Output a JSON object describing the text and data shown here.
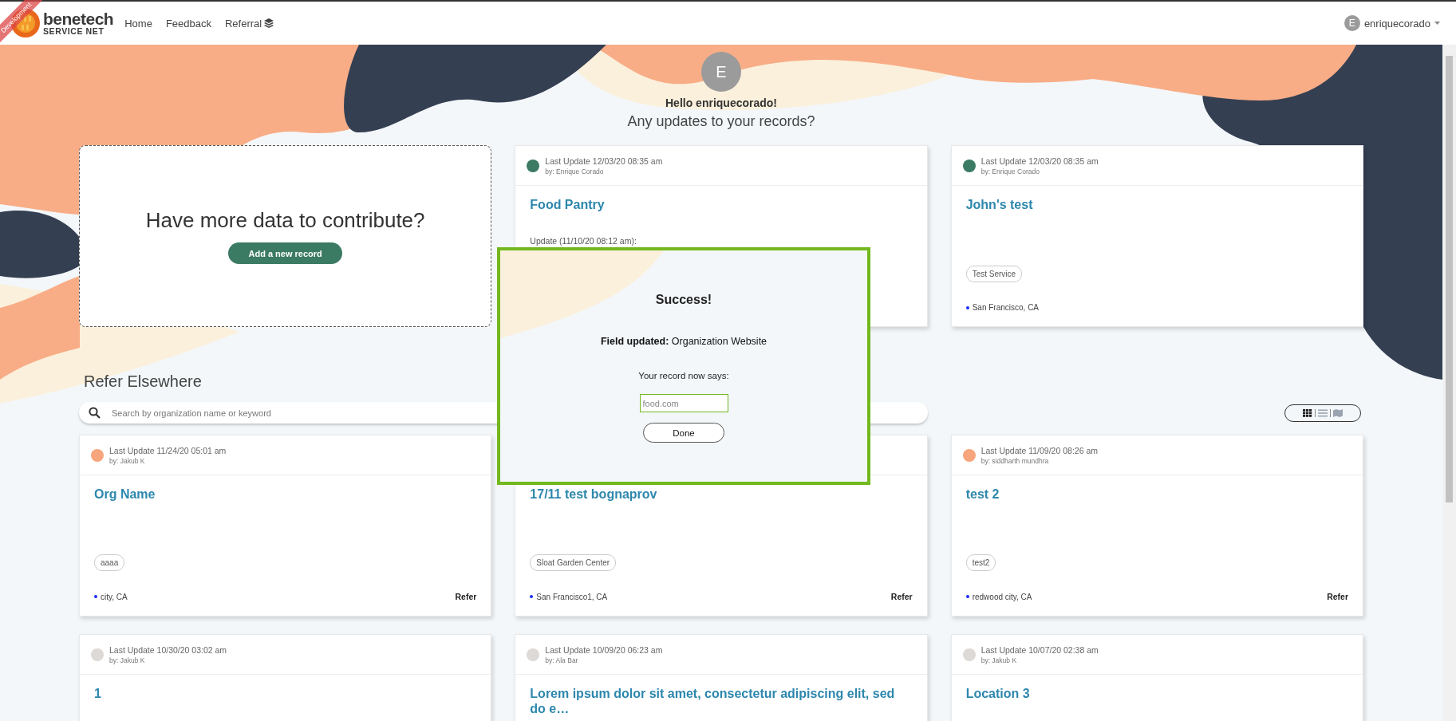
{
  "header": {
    "logo": {
      "name": "benetech",
      "tagline": "SERVICE NET"
    },
    "ribbon": "Development",
    "nav": [
      {
        "label": "Home",
        "kind": "plain"
      },
      {
        "label": "Feedback",
        "kind": "plain"
      },
      {
        "label": "Referral",
        "kind": "iconed"
      }
    ],
    "user": {
      "initial": "E",
      "name": "enriquecorado"
    }
  },
  "welcome": {
    "initial": "E",
    "greeting": "Hello enriquecorado!",
    "question": "Any updates to your records?"
  },
  "contribute": {
    "title": "Have more data to contribute?",
    "button": "Add a new record"
  },
  "my_records": [
    {
      "color": "#3b7a63",
      "last_update": "Last Update 12/03/20 08:35 am",
      "by": "by: Enrique Corado",
      "title": "Food Pantry",
      "note": "Update (11/10/20 08:12 am):"
    },
    {
      "color": "#3b7a63",
      "last_update": "Last Update 12/03/20 08:35 am",
      "by": "by: Enrique Corado",
      "title": "John's test",
      "tags": [
        "Test Service"
      ],
      "location": "San Francisco, CA"
    }
  ],
  "refer": {
    "title": "Refer Elsewhere",
    "search": {
      "placeholder": "Search by organization name or keyword"
    },
    "view_toggle": [
      {
        "kind": "grid",
        "selected": true
      },
      {
        "kind": "list",
        "selected": false
      },
      {
        "kind": "map",
        "selected": false
      }
    ],
    "records": [
      {
        "color": "#f6a57c",
        "last_update": "Last Update 11/24/20 05:01 am",
        "by": "by: Jakub K",
        "title": "Org Name",
        "tags": [
          "aaaa"
        ],
        "location": "city, CA",
        "action": "Refer"
      },
      {
        "title": "17/11 test bognaprov",
        "tags": [
          "Sloat Garden Center"
        ],
        "location": "San Francisco1, CA",
        "action": "Refer"
      },
      {
        "color": "#f6a57c",
        "last_update": "Last Update 11/09/20 08:26 am",
        "by": "by: siddharth mundhra",
        "title": "test 2",
        "tags": [
          "test2"
        ],
        "location": "redwood city, CA",
        "action": "Refer"
      },
      {
        "color": "#dcd9d6",
        "last_update": "Last Update 10/30/20 03:02 am",
        "by": "by: Jakub K",
        "title": "1"
      },
      {
        "color": "#dcd9d6",
        "last_update": "Last Update 10/09/20 06:23 am",
        "by": "by: Ala Bar",
        "title": "Lorem ipsum dolor sit amet, consectetur adipiscing elit, sed do e…"
      },
      {
        "color": "#dcd9d6",
        "last_update": "Last Update 10/07/20 02:38 am",
        "by": "by: Jakub K",
        "title": "Location 3"
      }
    ]
  },
  "modal": {
    "title": "Success!",
    "field": "**Field updated:** Organization Website",
    "caption": "Your record now says:",
    "value": "food.com",
    "button": "Done"
  }
}
